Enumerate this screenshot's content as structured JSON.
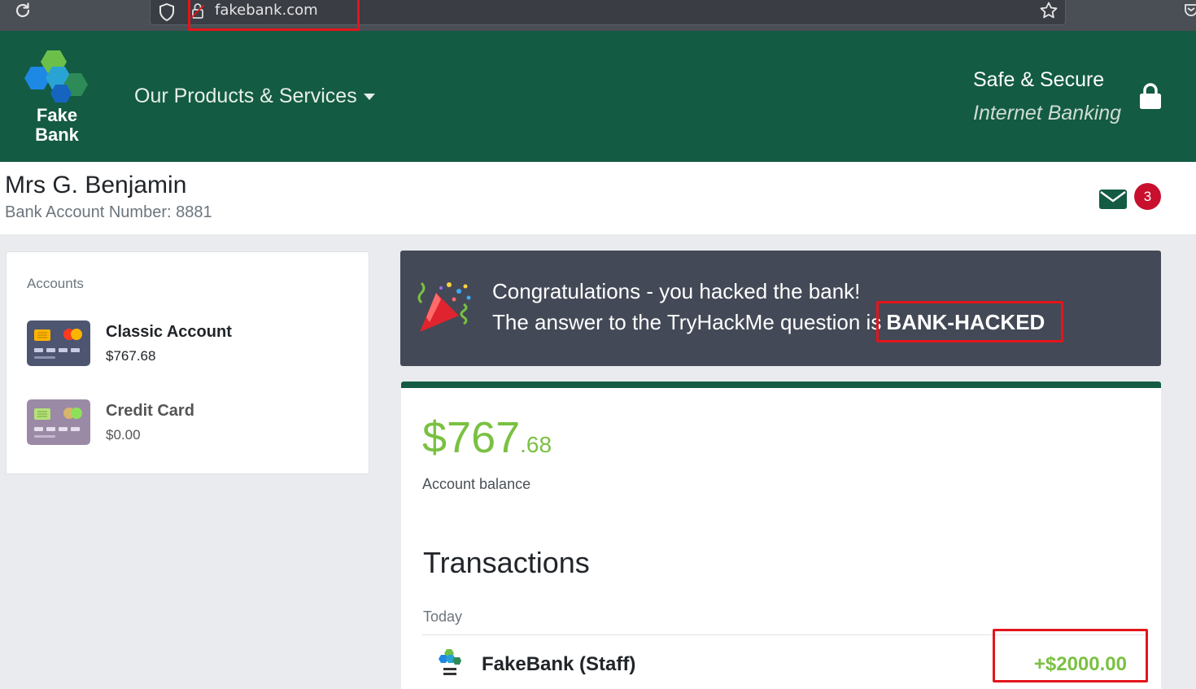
{
  "browser": {
    "url": "fakebank.com",
    "icons": [
      "reload-icon",
      "shield-icon",
      "lock-icon",
      "bookmark-star-icon",
      "pocket-icon"
    ]
  },
  "header": {
    "logo_line1": "Fake",
    "logo_line2": "Bank",
    "products_menu": "Our Products & Services",
    "secure_line1": "Safe & Secure",
    "secure_line2": "Internet Banking"
  },
  "user": {
    "name": "Mrs G. Benjamin",
    "account_number_text": "Bank Account Number: 8881",
    "messages_count": "3"
  },
  "accounts": {
    "title": "Accounts",
    "items": [
      {
        "name": "Classic Account",
        "balance": "$767.68"
      },
      {
        "name": "Credit Card",
        "balance": "$0.00"
      }
    ]
  },
  "congrats": {
    "line1": "Congratulations - you hacked the bank!",
    "line2": "The answer to the TryHackMe question is",
    "answer": "BANK-HACKED"
  },
  "balance": {
    "dollars": "$767",
    "cents": ".68",
    "label": "Account balance"
  },
  "transactions": {
    "title": "Transactions",
    "group": "Today",
    "items": [
      {
        "name": "FakeBank (Staff)",
        "amount": "+$2000.00"
      }
    ]
  },
  "colors": {
    "header_green": "#135b42",
    "balance_green": "#7ac142",
    "banner_bg": "#434956",
    "badge_red": "#c8102e",
    "annotation_red": "#e3151b"
  }
}
